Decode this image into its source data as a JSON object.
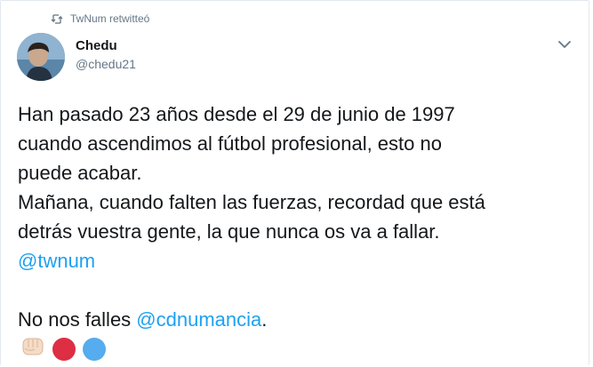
{
  "retweet": {
    "text": "TwNum retwitteó",
    "icon": "retweet-icon"
  },
  "author": {
    "name": "Chedu",
    "handle": "@chedu21",
    "avatar_icon": "avatar"
  },
  "menu": {
    "icon": "chevron-down-icon"
  },
  "tweet": {
    "line1": "Han pasado 23 años desde el 29 de junio de 1997",
    "line2": "cuando ascendimos al fútbol profesional, esto no",
    "line3": "puede acabar.",
    "line4": "Mañana, cuando falten las fuerzas, recordad que está",
    "line5": "detrás vuestra gente, la que nunca os va a fallar.",
    "mention1": "@twnum",
    "line7_prefix": "No nos falles ",
    "mention2": "@cdnumancia",
    "line7_suffix": "."
  },
  "emojis": [
    {
      "name": "fist-icon",
      "color": "#f2d7c0"
    },
    {
      "name": "red-circle-icon",
      "color": "#dd2e44"
    },
    {
      "name": "blue-circle-icon",
      "color": "#55acee"
    }
  ],
  "colors": {
    "link": "#1da1f2",
    "secondary": "#657786",
    "text": "#14171a"
  }
}
